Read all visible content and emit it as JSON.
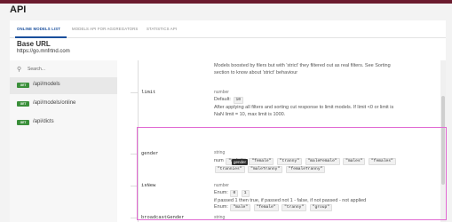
{
  "app": {
    "title": "API"
  },
  "tabs": [
    {
      "label": "ONLINE MODELS LIST"
    },
    {
      "label": "MODELS API FOR AGGREGATORS"
    },
    {
      "label": "STATISTICS API"
    }
  ],
  "base_url": {
    "label": "Base URL",
    "value": "https://go.mnfrtnd.com"
  },
  "sidebar": {
    "search_placeholder": "Search...",
    "items": [
      {
        "method": "GET",
        "path": "/api/models"
      },
      {
        "method": "GET",
        "path": "/api/models/online"
      },
      {
        "method": "GET",
        "path": "/api/dicts"
      }
    ]
  },
  "content": {
    "intro_line1": "Models boosted by filers but with 'strict' they filtered out as real filters. See Sorting",
    "intro_line2": "section to know about 'strict' behaviour",
    "params": [
      {
        "name": "limit",
        "type": "number",
        "default_label": "Default:",
        "default_value": "10",
        "desc_line1": "After applying all filters and sorting cut response to limit models. If limit <0 or limit is",
        "desc_line2": "NaN limit = 10, max limit is 1000."
      },
      {
        "name": "gender",
        "type": "string",
        "enum_prefix": "num",
        "enum": [
          "\"male\"",
          "\"female\"",
          "\"tranny\"",
          "\"maleFemale\"",
          "\"males\"",
          "\"females\"",
          "\"trannies\"",
          "\"maleTranny\"",
          "\"femaleTranny\""
        ],
        "tooltip": "gender"
      },
      {
        "name": "isNew",
        "type": "number",
        "enum_label": "Enum:",
        "enum": [
          "0",
          "1"
        ],
        "desc": "if passed 1 then true, if passed not 1 - false, if not passed - not applied"
      },
      {
        "name": "broadcastGender",
        "type": "string",
        "enum_label": "Enum:",
        "enum": [
          "\"male\"",
          "\"female\"",
          "\"tranny\"",
          "\"group\""
        ]
      }
    ]
  },
  "colors": {
    "topbar": "#6b1b2e",
    "accent": "#1a4f9c",
    "get_badge": "#3a8f3a",
    "highlight": "#e16ad2"
  }
}
